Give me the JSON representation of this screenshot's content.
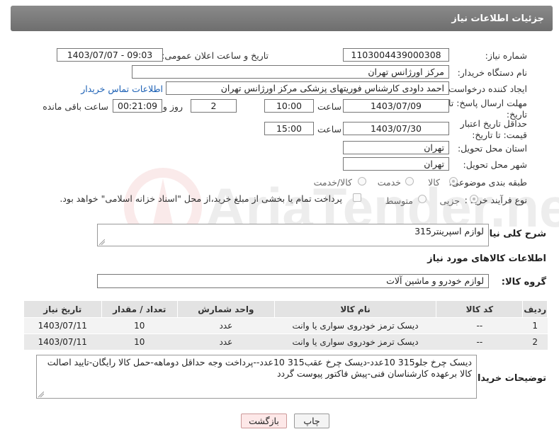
{
  "header": {
    "title": "جزئیات اطلاعات نیاز"
  },
  "form": {
    "need_number_label": "شماره نیاز:",
    "need_number": "1103004439000308",
    "announce_label": "تاریخ و ساعت اعلان عمومی:",
    "announce_value": "1403/07/07 - 09:03",
    "buyer_org_label": "نام دستگاه خریدار:",
    "buyer_org": "مرکز اورژانس تهران",
    "requester_label": "ایجاد کننده درخواست:",
    "requester": "احمد داودی کارشناس فوریتهای پزشکی مرکز اورژانس تهران",
    "contact_link": "اطلاعات تماس خریدار",
    "deadline_label": "مهلت ارسال پاسخ: تا تاریخ:",
    "deadline_date": "1403/07/09",
    "time_label": "ساعت",
    "deadline_time": "10:00",
    "days_value": "2",
    "days_label": "روز و",
    "remaining_value": "00:21:09",
    "remaining_label": "ساعت باقی مانده",
    "validity_label": "حداقل تاریخ اعتبار قیمت: تا تاریخ:",
    "validity_date": "1403/07/30",
    "validity_time": "15:00",
    "province_label": "استان محل تحویل:",
    "province": "تهران",
    "city_label": "شهر محل تحویل:",
    "city": "تهران",
    "category_label": "طبقه بندی موضوعی:",
    "category_options": [
      "کالا",
      "خدمت",
      "کالا/خدمت"
    ],
    "process_label": "نوع فرآیند خرید :",
    "process_options": [
      "جزیی",
      "متوسط"
    ],
    "treasury_note": "پرداخت تمام یا بخشی از مبلغ خرید،از محل \"اسناد خزانه اسلامی\" خواهد بود."
  },
  "description": {
    "label": "شرح کلی نیاز:",
    "value": "لوازم اسپرینتر315"
  },
  "goods_info_title": "اطلاعات کالاهای مورد نیاز",
  "goods_group": {
    "label": "گروه کالا:",
    "value": "لوازم خودرو و ماشین آلات"
  },
  "table": {
    "headers": [
      "ردیف",
      "کد کالا",
      "نام کالا",
      "واحد شمارش",
      "تعداد / مقدار",
      "تاریخ نیاز"
    ],
    "rows": [
      {
        "row": "1",
        "code": "--",
        "name": "دیسک ترمز خودروی سواری یا وانت",
        "unit": "عدد",
        "qty": "10",
        "date": "1403/07/11"
      },
      {
        "row": "2",
        "code": "--",
        "name": "دیسک ترمز خودروی سواری یا وانت",
        "unit": "عدد",
        "qty": "10",
        "date": "1403/07/11"
      }
    ]
  },
  "buyer_notes": {
    "label": "توضیحات خریدار:",
    "value": "دیسک چرخ جلو315    10عدد-دیسک چرخ عقب315    10عدد--پرداخت وجه حداقل دوماهه-حمل کالا رایگان-تایید اصالت کالا برعهده کارشناسان فنی-پیش فاکتور پیوست گردد"
  },
  "buttons": {
    "print": "چاپ",
    "back": "بازگشت"
  },
  "watermark": {
    "text": "AriaTender.net",
    "color": "#cc2222"
  }
}
